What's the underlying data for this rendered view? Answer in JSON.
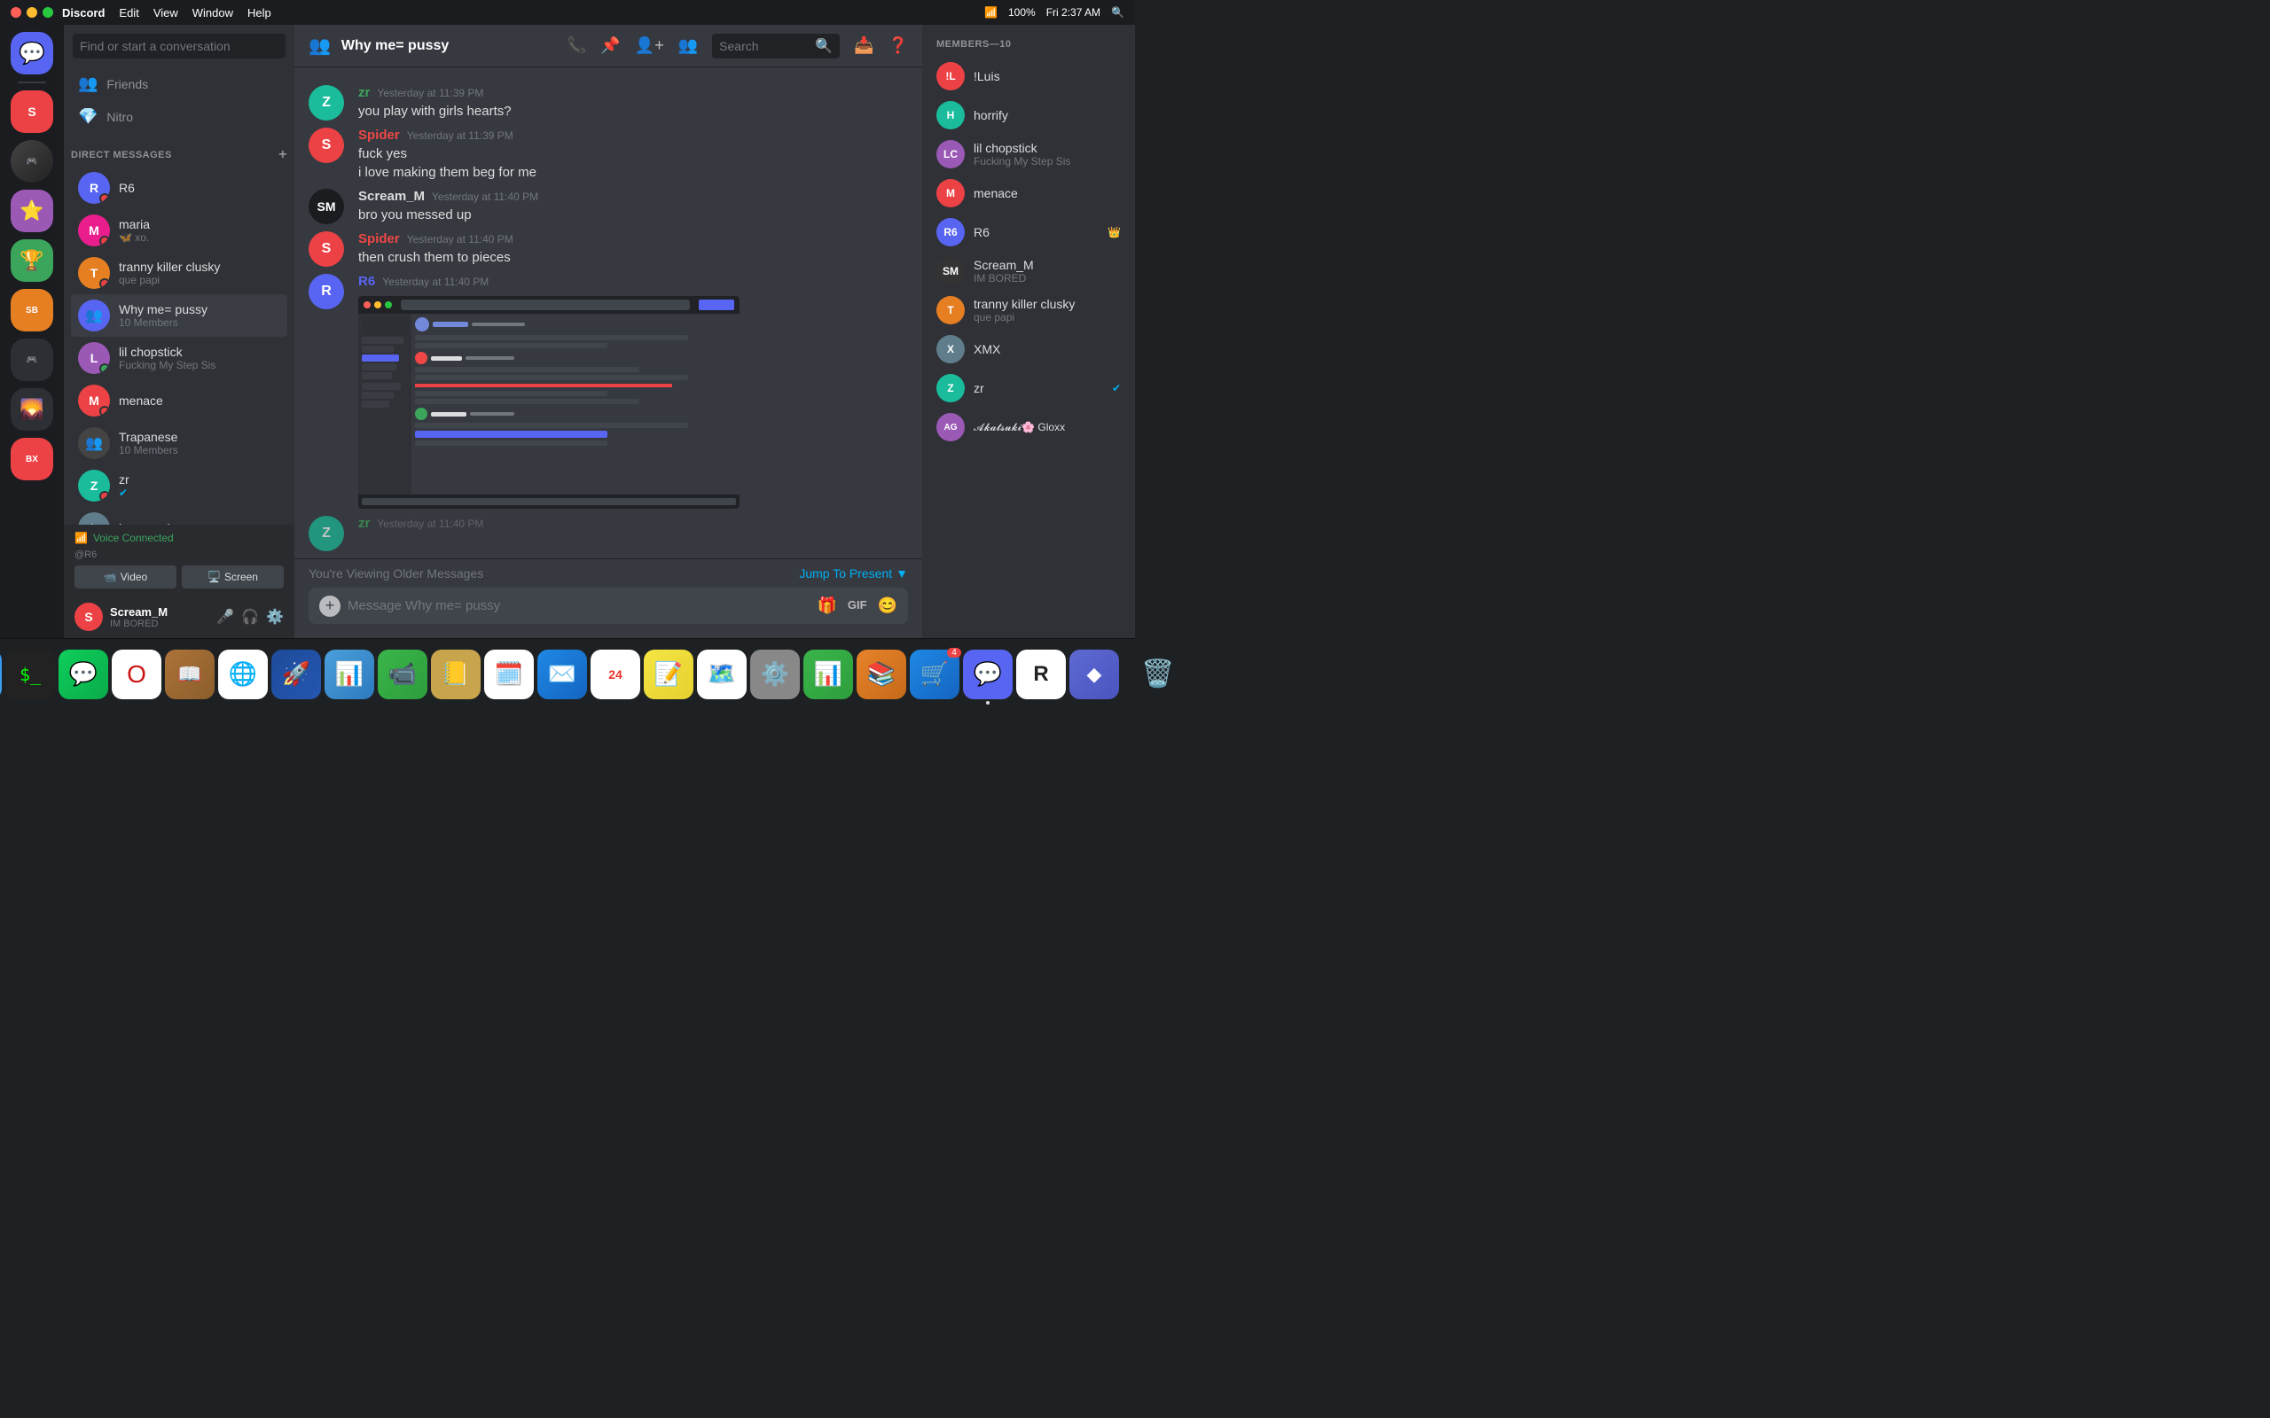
{
  "titlebar": {
    "app_name": "Discord",
    "menus": [
      "Edit",
      "View",
      "Window",
      "Help"
    ],
    "time": "Fri 2:37 AM",
    "battery": "100%"
  },
  "dm_sidebar": {
    "search_placeholder": "Find or start a conversation",
    "nav_items": [
      {
        "label": "Friends",
        "icon": "👥"
      },
      {
        "label": "Nitro",
        "icon": "💎"
      }
    ],
    "section_label": "DIRECT MESSAGES",
    "dm_list": [
      {
        "name": "R6",
        "status": "",
        "members": "",
        "type": "user"
      },
      {
        "name": "maria",
        "status": "🦋 xo.",
        "members": "",
        "type": "user"
      },
      {
        "name": "tranny killer clusky",
        "status": "que papi",
        "members": "",
        "type": "user"
      },
      {
        "name": "Why me= pussy",
        "status": "10 Members",
        "members": "10",
        "type": "group",
        "active": true
      },
      {
        "name": "lil chopstick",
        "status": "Fucking My Step Sis",
        "members": "",
        "type": "user"
      },
      {
        "name": "menace",
        "status": "",
        "members": "",
        "type": "user"
      },
      {
        "name": "Trapanese",
        "status": "10 Members",
        "members": "10",
        "type": "group"
      },
      {
        "name": "zr",
        "status": "✔",
        "members": "",
        "type": "user"
      },
      {
        "name": "lxser_arri",
        "status": "",
        "members": "",
        "type": "user"
      }
    ],
    "voice_connected": "Voice Connected",
    "voice_user": "@R6",
    "video_btn": "Video",
    "screen_btn": "Screen",
    "user_name": "Scream_M",
    "user_status": "IM BORED"
  },
  "chat": {
    "channel_name": "Why me= pussy",
    "channel_icon": "👥",
    "messages": [
      {
        "author": "zr",
        "time": "Yesterday at 11:39 PM",
        "text": "you play with girls hearts?",
        "has_image": false
      },
      {
        "author": "Spider",
        "time": "Yesterday at 11:39 PM",
        "text": "fuck yes\ni love making them beg for me",
        "has_image": false
      },
      {
        "author": "Scream_M",
        "time": "Yesterday at 11:40 PM",
        "text": "bro you messed up",
        "has_image": false
      },
      {
        "author": "Spider",
        "time": "Yesterday at 11:40 PM",
        "text": "then crush them to pieces",
        "has_image": false
      },
      {
        "author": "R6",
        "time": "Yesterday at 11:40 PM",
        "text": "",
        "has_image": true
      }
    ],
    "older_messages_text": "You're Viewing Older Messages",
    "jump_to_present": "Jump To Present",
    "input_placeholder": "Message Why me= pussy",
    "search_placeholder": "Search"
  },
  "members": {
    "header": "MEMBERS—10",
    "list": [
      {
        "name": "!Luis",
        "sub": "",
        "status": "online"
      },
      {
        "name": "horrify",
        "sub": "",
        "status": "online"
      },
      {
        "name": "lil chopstick",
        "sub": "Fucking My Step Sis",
        "status": "online"
      },
      {
        "name": "menace",
        "sub": "",
        "status": "dnd"
      },
      {
        "name": "R6",
        "sub": "",
        "status": "online"
      },
      {
        "name": "Scream_M",
        "sub": "IM BORED",
        "status": "dnd"
      },
      {
        "name": "tranny killer clusky",
        "sub": "que papi",
        "status": "dnd"
      },
      {
        "name": "XMX",
        "sub": "",
        "status": "offline"
      },
      {
        "name": "zr",
        "sub": "",
        "status": "online"
      },
      {
        "name": "𝓐𝓴𝓪𝓽𝓼𝓾𝓴𝓲🌸 Gloxx",
        "sub": "",
        "status": "offline"
      }
    ]
  },
  "dock": {
    "items": [
      {
        "label": "Finder",
        "icon": "🔵",
        "color": "#1e88e5"
      },
      {
        "label": "Terminal",
        "icon": "⬛",
        "color": "#222"
      },
      {
        "label": "Messages",
        "icon": "💬",
        "color": "#3ab54a"
      },
      {
        "label": "Opera",
        "icon": "🔴",
        "color": "#cc1616"
      },
      {
        "label": "Dictionary",
        "icon": "📖",
        "color": "#ac7339"
      },
      {
        "label": "Chrome",
        "icon": "🌐",
        "color": "#f5c518"
      },
      {
        "label": "Rocket",
        "icon": "🚀",
        "color": "#1e4b99"
      },
      {
        "label": "Keynote",
        "icon": "📊",
        "color": "#4b9fdb"
      },
      {
        "label": "FaceTime",
        "icon": "📹",
        "color": "#3ab54a"
      },
      {
        "label": "Notefile",
        "icon": "📒",
        "color": "#c8a44c"
      },
      {
        "label": "Calendar",
        "icon": "📅",
        "color": "#e8342a"
      },
      {
        "label": "Mail",
        "icon": "✉️",
        "color": "#1e88e5"
      },
      {
        "label": "Calendar24",
        "icon": "24",
        "color": "#e8342a"
      },
      {
        "label": "Notes",
        "icon": "📝",
        "color": "#f5e642"
      },
      {
        "label": "Maps",
        "icon": "🗺️",
        "color": "#3ab54a"
      },
      {
        "label": "Settings",
        "icon": "⚙️",
        "color": "#888"
      },
      {
        "label": "Numbers",
        "icon": "📊",
        "color": "#3ab54a"
      },
      {
        "label": "Books",
        "icon": "📚",
        "color": "#e8832a"
      },
      {
        "label": "AppStore",
        "icon": "🛒",
        "color": "#1e88e5",
        "badge": "4"
      },
      {
        "label": "Discord",
        "icon": "💜",
        "color": "#5865f2"
      },
      {
        "label": "Roblox",
        "icon": "⬜",
        "color": "#222"
      },
      {
        "label": "Linear",
        "icon": "◆",
        "color": "#5e6ad2"
      },
      {
        "label": "Trash",
        "icon": "🗑️",
        "color": "#888"
      }
    ]
  }
}
